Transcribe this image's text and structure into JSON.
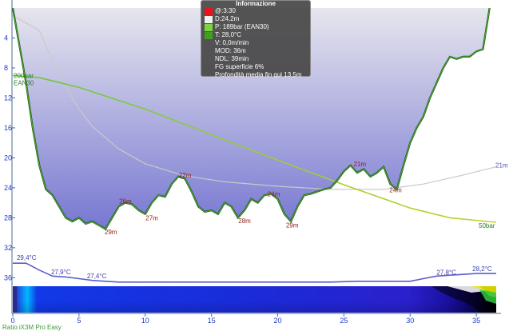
{
  "chart_data": {
    "type": "area",
    "x_ticks": [
      0,
      5,
      10,
      15,
      20,
      25,
      30,
      35
    ],
    "y_ticks": [
      4,
      8,
      12,
      16,
      20,
      24,
      28,
      32,
      36
    ],
    "xlim": [
      0,
      36.5
    ],
    "ylim_depth": [
      0,
      36.5
    ],
    "depth_profile": {
      "x": [
        0,
        0.5,
        1,
        1.5,
        2,
        2.5,
        3,
        3.5,
        4,
        4.5,
        5,
        5.5,
        6,
        6.5,
        7,
        7.5,
        8,
        8.5,
        9,
        9.5,
        10,
        10.5,
        11,
        11.5,
        12,
        12.5,
        13,
        13.5,
        14,
        14.5,
        15,
        15.5,
        16,
        16.5,
        17,
        17.5,
        18,
        18.5,
        19,
        19.5,
        20,
        20.5,
        21,
        21.5,
        22,
        22.5,
        23,
        23.5,
        24,
        24.5,
        25,
        25.5,
        26,
        26.5,
        27,
        27.5,
        28,
        28.5,
        29,
        29.5,
        30,
        30.5,
        31,
        31.5,
        32,
        32.5,
        33,
        33.5,
        34,
        34.5,
        35,
        35.5,
        36
      ],
      "y": [
        0,
        5,
        10,
        16,
        21,
        24.2,
        25,
        26.5,
        28,
        28.5,
        28,
        28.8,
        28.5,
        29,
        29.5,
        28,
        26.5,
        26,
        26.2,
        27,
        27.5,
        26,
        25,
        25.2,
        23.5,
        22.5,
        22.8,
        24.5,
        26.5,
        27.2,
        27,
        27.5,
        26,
        26.5,
        28,
        27,
        25.5,
        26,
        25,
        24.8,
        25.5,
        27.5,
        28.5,
        26.5,
        25,
        24.8,
        24.5,
        24.2,
        24,
        23,
        21.8,
        21,
        22,
        21.5,
        22.5,
        22,
        21.2,
        23.5,
        24.2,
        21,
        18,
        16,
        14.5,
        12,
        10,
        8,
        6.5,
        6.8,
        6.5,
        6.5,
        5.8,
        5.5,
        0
      ]
    },
    "depth_labels": [
      {
        "text": "29m",
        "x": 7.4,
        "y": 29.9
      },
      {
        "text": "26m",
        "x": 8.5,
        "y": 25.8
      },
      {
        "text": "27m",
        "x": 10.5,
        "y": 28.0
      },
      {
        "text": "22m",
        "x": 13.0,
        "y": 22.3
      },
      {
        "text": "28m",
        "x": 17.5,
        "y": 28.4
      },
      {
        "text": "24m",
        "x": 19.7,
        "y": 24.8
      },
      {
        "text": "29m",
        "x": 21.1,
        "y": 29.0
      },
      {
        "text": "21m",
        "x": 26.2,
        "y": 20.8
      },
      {
        "text": "24m",
        "x": 28.9,
        "y": 24.3
      }
    ],
    "pressure_series": {
      "x": [
        0,
        2,
        5,
        10,
        15,
        20,
        25,
        30,
        33,
        36.5
      ],
      "y": [
        9.0,
        9.3,
        10.6,
        13.5,
        16.9,
        20.3,
        23.6,
        26.7,
        28.0,
        28.6
      ],
      "start_labels": [
        "200bar",
        "EAN30"
      ],
      "end_label": "50bar"
    },
    "ndl_series": {
      "x": [
        0,
        2,
        3,
        4,
        5,
        6,
        8,
        10,
        13,
        16,
        20,
        24,
        28,
        31,
        34,
        36.5
      ],
      "y": [
        1,
        3,
        7,
        10.5,
        13.5,
        15.8,
        18.8,
        20.8,
        22.4,
        23.2,
        23.8,
        24.2,
        24.2,
        23.5,
        22.3,
        21.2
      ],
      "end_label": "21m"
    },
    "temperature": {
      "x": [
        0,
        1,
        2,
        3,
        4,
        5,
        6,
        7,
        8,
        9,
        10,
        12,
        14,
        16,
        18,
        20,
        22,
        24,
        26,
        28,
        30,
        31,
        32,
        33,
        34,
        35,
        36,
        36.5
      ],
      "y": [
        29.4,
        29.4,
        28.6,
        27.9,
        27.8,
        27.6,
        27.4,
        27.3,
        27.2,
        27.2,
        27.2,
        27.2,
        27.2,
        27.2,
        27.2,
        27.2,
        27.2,
        27.2,
        27.3,
        27.3,
        27.3,
        27.6,
        27.9,
        28.0,
        28.1,
        28.2,
        28.2,
        28.2
      ],
      "range": [
        27.0,
        29.6
      ],
      "labels": [
        {
          "text": "29,4°C",
          "x": 0.3,
          "y": 29.6
        },
        {
          "text": "27,9°C",
          "x": 2.9,
          "y": 27.95
        },
        {
          "text": "27,4°C",
          "x": 5.6,
          "y": 27.45
        },
        {
          "text": "27,8°C",
          "x": 32.0,
          "y": 27.9
        },
        {
          "text": "28,2°C",
          "x": 34.7,
          "y": 28.3
        }
      ]
    },
    "colors": {
      "profile_top": "#d8d8e8",
      "profile_bottom": "#7a7ad4",
      "profile_line": "#3fae2a",
      "profile_edge": "#1d3a10",
      "ascent_line": "#a8cc2c",
      "pressure_line_start": "#6cc63c",
      "pressure_line_end": "#c6d22e",
      "ndl_line": "#c9c9c9",
      "temp_line": "#5c5ccc",
      "label_red": "#8b1d1d",
      "axis_text": "#1a3cc8"
    }
  },
  "info_panel": {
    "title": "Informazione",
    "rows": [
      {
        "text": "@:3:30",
        "swatch": "#e8141c"
      },
      {
        "text": "D:24,2m",
        "swatch": "#f0f0f0"
      },
      {
        "text": "P: 189bar (EAN30)",
        "swatch": "#7ad63e"
      },
      {
        "text": "T: 28,0°C",
        "swatch": "#3f9f1f"
      },
      {
        "text": "V: 0,0m/min",
        "swatch": ""
      },
      {
        "text": "MOD: 36m",
        "swatch": ""
      },
      {
        "text": "NDL: 39min",
        "swatch": ""
      },
      {
        "text": "FG superficie 6%",
        "swatch": ""
      },
      {
        "text": "Profondità media fin qui 13,5m",
        "swatch": ""
      }
    ]
  },
  "footer": "Ratio iX3M Pro Easy"
}
